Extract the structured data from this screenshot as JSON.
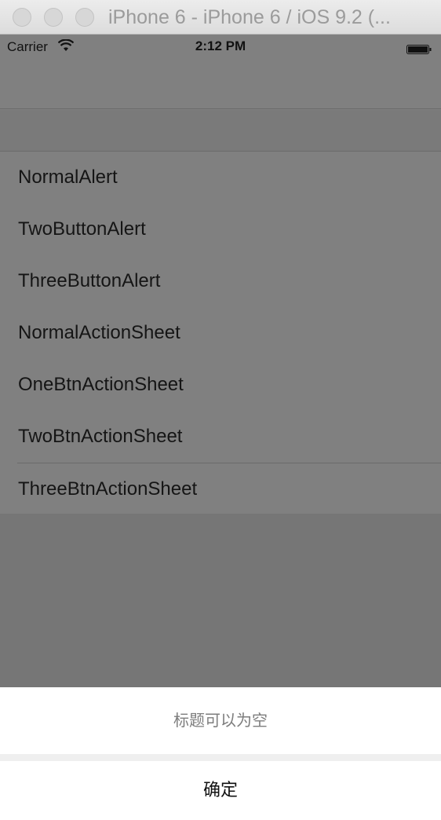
{
  "window": {
    "title": "iPhone 6 - iPhone 6 / iOS 9.2 (..."
  },
  "status_bar": {
    "carrier": "Carrier",
    "time": "2:12 PM",
    "wifi_icon": "wifi-icon",
    "battery_icon": "battery-full-icon"
  },
  "list": {
    "items": [
      {
        "label": "NormalAlert"
      },
      {
        "label": "TwoButtonAlert"
      },
      {
        "label": "ThreeButtonAlert"
      },
      {
        "label": "NormalActionSheet"
      },
      {
        "label": "OneBtnActionSheet"
      },
      {
        "label": "TwoBtnActionSheet"
      },
      {
        "label": "ThreeBtnActionSheet"
      }
    ]
  },
  "action_sheet": {
    "title": "标题可以为空",
    "confirm_label": "确定"
  },
  "colors": {
    "dim_overlay": "#808080",
    "sheet_background": "#ffffff",
    "sheet_title_text": "#7d7d7d"
  }
}
